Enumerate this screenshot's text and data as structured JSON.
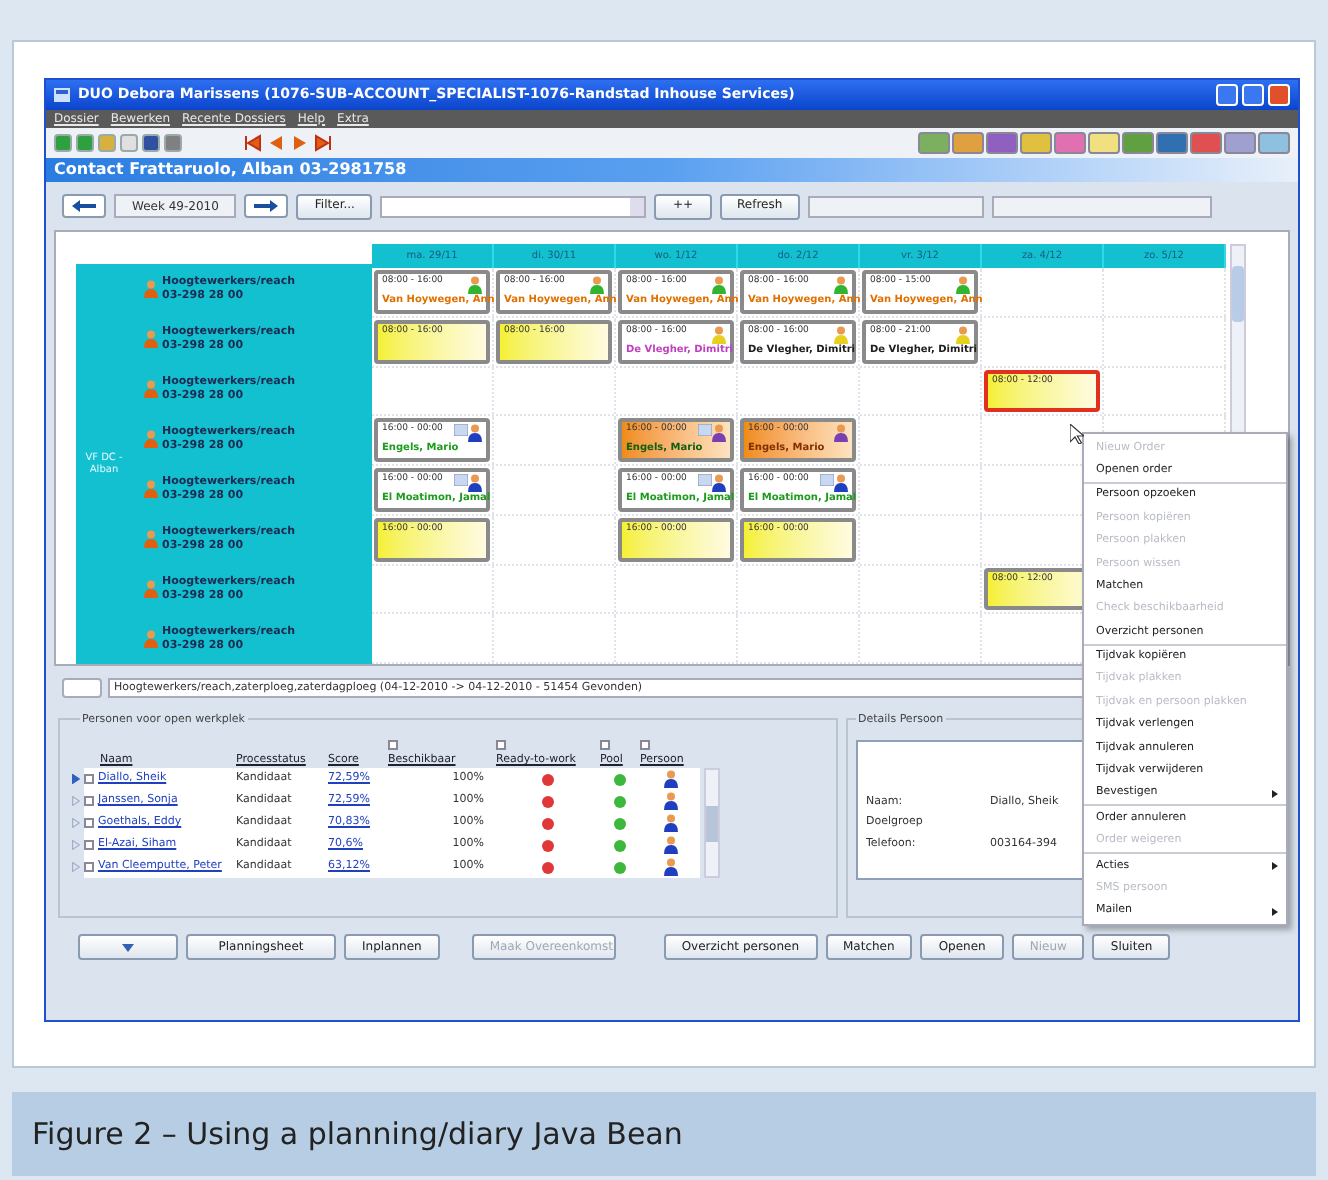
{
  "window": {
    "title": "DUO Debora Marissens (1076-SUB-ACCOUNT_SPECIALIST-1076-Randstad Inhouse Services)"
  },
  "menu": [
    "Dossier",
    "Bewerken",
    "Recente Dossiers",
    "Help",
    "Extra"
  ],
  "header": "Contact Frattaruolo, Alban 03-2981758",
  "nav": {
    "week": "Week 49-2010",
    "filter": "Filter...",
    "plus": "++",
    "refresh": "Refresh"
  },
  "calendar": {
    "group": "VF DC - Alban",
    "days": [
      "ma. 29/11",
      "di. 30/11",
      "wo. 1/12",
      "do. 2/12",
      "vr. 3/12",
      "za. 4/12",
      "zo. 5/12"
    ],
    "rows": [
      {
        "label": "Hoogtewerkers/reach",
        "phone": "03-298 28 00",
        "cells": [
          {
            "kind": "white",
            "time": "08:00 - 16:00",
            "name": "Van Hoywegen, Ann",
            "color": "#e07000",
            "person": {
              "color": "#2fb52f"
            },
            "note": false,
            "selected": false
          },
          {
            "kind": "white",
            "time": "08:00 - 16:00",
            "name": "Van Hoywegen, Ann",
            "color": "#e07000",
            "person": {
              "color": "#2fb52f"
            },
            "note": false,
            "selected": false
          },
          {
            "kind": "white",
            "time": "08:00 - 16:00",
            "name": "Van Hoywegen, Ann",
            "color": "#e07000",
            "person": {
              "color": "#2fb52f"
            },
            "note": false,
            "selected": false
          },
          {
            "kind": "white",
            "time": "08:00 - 16:00",
            "name": "Van Hoywegen, Ann",
            "color": "#e07000",
            "person": {
              "color": "#2fb52f"
            },
            "note": false,
            "selected": false
          },
          {
            "kind": "white",
            "time": "08:00 - 15:00",
            "name": "Van Hoywegen, Ann",
            "color": "#e07000",
            "person": {
              "color": "#2fb52f"
            },
            "note": false,
            "selected": false
          },
          {
            "kind": "empty"
          },
          {
            "kind": "empty"
          }
        ]
      },
      {
        "label": "Hoogtewerkers/reach",
        "phone": "03-298 28 00",
        "cells": [
          {
            "kind": "yellow",
            "time": "08:00 - 16:00",
            "selected": false
          },
          {
            "kind": "yellow",
            "time": "08:00 - 16:00",
            "selected": false
          },
          {
            "kind": "white",
            "time": "08:00 - 16:00",
            "name": "De Vlegher, Dimitri",
            "color": "#c040c0",
            "person": {
              "color": "#e8d020"
            },
            "note": false,
            "selected": false
          },
          {
            "kind": "white",
            "time": "08:00 - 16:00",
            "name": "De Vlegher, Dimitri",
            "color": "#202020",
            "person": {
              "color": "#e8d020"
            },
            "note": false,
            "selected": false
          },
          {
            "kind": "white",
            "time": "08:00 - 21:00",
            "name": "De Vlegher, Dimitri",
            "color": "#202020",
            "person": {
              "color": "#e8d020"
            },
            "note": false,
            "selected": false
          },
          {
            "kind": "empty"
          },
          {
            "kind": "empty"
          }
        ]
      },
      {
        "label": "Hoogtewerkers/reach",
        "phone": "03-298 28 00",
        "cells": [
          {
            "kind": "empty"
          },
          {
            "kind": "empty"
          },
          {
            "kind": "empty"
          },
          {
            "kind": "empty"
          },
          {
            "kind": "empty"
          },
          {
            "kind": "yellow",
            "time": "08:00 - 12:00",
            "selected": true
          },
          {
            "kind": "empty"
          }
        ]
      },
      {
        "label": "Hoogtewerkers/reach",
        "phone": "03-298 28 00",
        "cells": [
          {
            "kind": "white",
            "time": "16:00 - 00:00",
            "name": "Engels, Mario",
            "color": "#1c9c1c",
            "person": {
              "color": "#1f3fc0"
            },
            "note": true,
            "selected": false
          },
          {
            "kind": "empty"
          },
          {
            "kind": "orange",
            "time": "16:00 - 00:00",
            "name": "Engels, Mario",
            "color": "#106010",
            "person": {
              "color": "#7a3fb0"
            },
            "note": true,
            "selected": false
          },
          {
            "kind": "orange",
            "time": "16:00 - 00:00",
            "name": "Engels, Mario",
            "color": "#803000",
            "person": {
              "color": "#7a3fb0"
            },
            "note": false,
            "selected": false
          },
          {
            "kind": "empty"
          },
          {
            "kind": "empty"
          },
          {
            "kind": "empty"
          }
        ]
      },
      {
        "label": "Hoogtewerkers/reach",
        "phone": "03-298 28 00",
        "cells": [
          {
            "kind": "white",
            "time": "16:00 - 00:00",
            "name": "El Moatimon, Jamal",
            "color": "#1c9c1c",
            "person": {
              "color": "#1f3fc0"
            },
            "note": true,
            "selected": false
          },
          {
            "kind": "empty"
          },
          {
            "kind": "white",
            "time": "16:00 - 00:00",
            "name": "El Moatimon, Jamal",
            "color": "#1c9c1c",
            "person": {
              "color": "#1f3fc0"
            },
            "note": true,
            "selected": false
          },
          {
            "kind": "white",
            "time": "16:00 - 00:00",
            "name": "El Moatimon, Jamal",
            "color": "#1c9c1c",
            "person": {
              "color": "#1f3fc0"
            },
            "note": true,
            "selected": false
          },
          {
            "kind": "empty"
          },
          {
            "kind": "empty"
          },
          {
            "kind": "empty"
          }
        ]
      },
      {
        "label": "Hoogtewerkers/reach",
        "phone": "03-298 28 00",
        "cells": [
          {
            "kind": "yellow",
            "time": "16:00 - 00:00",
            "selected": false
          },
          {
            "kind": "empty"
          },
          {
            "kind": "yellow",
            "time": "16:00 - 00:00",
            "selected": false
          },
          {
            "kind": "yellow",
            "time": "16:00 - 00:00",
            "selected": false
          },
          {
            "kind": "empty"
          },
          {
            "kind": "empty"
          },
          {
            "kind": "empty"
          }
        ]
      },
      {
        "label": "Hoogtewerkers/reach",
        "phone": "03-298 28 00",
        "cells": [
          {
            "kind": "empty"
          },
          {
            "kind": "empty"
          },
          {
            "kind": "empty"
          },
          {
            "kind": "empty"
          },
          {
            "kind": "empty"
          },
          {
            "kind": "yellow",
            "time": "08:00 - 12:00",
            "selected": false
          },
          {
            "kind": "empty"
          }
        ]
      },
      {
        "label": "Hoogtewerkers/reach",
        "phone": "03-298 28 00",
        "cells": [
          {
            "kind": "empty"
          },
          {
            "kind": "empty"
          },
          {
            "kind": "empty"
          },
          {
            "kind": "empty"
          },
          {
            "kind": "empty"
          },
          {
            "kind": "empty"
          },
          {
            "kind": "empty"
          }
        ]
      }
    ]
  },
  "context_menu": [
    [
      {
        "label": "Nieuw Order",
        "disabled": true
      },
      {
        "label": "Openen order",
        "disabled": false
      }
    ],
    [
      {
        "label": "Persoon opzoeken",
        "disabled": false
      },
      {
        "label": "Persoon kopiëren",
        "disabled": true
      },
      {
        "label": "Persoon plakken",
        "disabled": true
      },
      {
        "label": "Persoon wissen",
        "disabled": true
      },
      {
        "label": "Matchen",
        "disabled": false
      },
      {
        "label": "Check beschikbaarheid",
        "disabled": true
      },
      {
        "label": "Overzicht personen",
        "disabled": false
      }
    ],
    [
      {
        "label": "Tijdvak kopiëren",
        "disabled": false
      },
      {
        "label": "Tijdvak plakken",
        "disabled": true
      },
      {
        "label": "Tijdvak en persoon plakken",
        "disabled": true
      },
      {
        "label": "Tijdvak verlengen",
        "disabled": false
      },
      {
        "label": "Tijdvak annuleren",
        "disabled": false
      },
      {
        "label": "Tijdvak verwijderen",
        "disabled": false
      },
      {
        "label": "Bevestigen",
        "disabled": false,
        "submenu": true
      }
    ],
    [
      {
        "label": "Order annuleren",
        "disabled": false
      },
      {
        "label": "Order weigeren",
        "disabled": true
      }
    ],
    [
      {
        "label": "Acties",
        "disabled": false,
        "submenu": true
      },
      {
        "label": "SMS persoon",
        "disabled": true
      },
      {
        "label": "Mailen",
        "disabled": false,
        "submenu": true
      }
    ]
  ],
  "search_result": "Hoogtewerkers/reach,zaterploeg,zaterdagploeg (04-12-2010 -> 04-12-2010 - 51454 Gevonden)",
  "persons": {
    "title": "Personen voor open werkplek",
    "columns": [
      {
        "label": "Naam"
      },
      {
        "label": "Processtatus"
      },
      {
        "label": "Score"
      },
      {
        "label": "Beschikbaar",
        "checked": false
      },
      {
        "label": "Ready-to-work",
        "checked": false
      },
      {
        "label": "Pool",
        "checked": false
      },
      {
        "label": "Persoon",
        "checked": false
      }
    ],
    "rows": [
      {
        "name": "Diallo, Sheik",
        "status": "Kandidaat",
        "score": "72,59%",
        "available": "100%",
        "ready": false,
        "pool": true,
        "checked": false,
        "selected": true
      },
      {
        "name": "Janssen, Sonja",
        "status": "Kandidaat",
        "score": "72,59%",
        "available": "100%",
        "ready": false,
        "pool": true,
        "checked": false,
        "selected": false
      },
      {
        "name": "Goethals, Eddy",
        "status": "Kandidaat",
        "score": "70,83%",
        "available": "100%",
        "ready": false,
        "pool": true,
        "checked": false,
        "selected": false
      },
      {
        "name": "El-Azai, Siham",
        "status": "Kandidaat",
        "score": "70,6%",
        "available": "100%",
        "ready": false,
        "pool": true,
        "checked": false,
        "selected": false
      },
      {
        "name": "Van Cleemputte, Peter",
        "status": "Kandidaat",
        "score": "63,12%",
        "available": "100%",
        "ready": false,
        "pool": true,
        "checked": false,
        "selected": false
      }
    ]
  },
  "details": {
    "title": "Details Persoon",
    "fields": [
      {
        "label": "Naam:",
        "value": "Diallo, Sheik"
      },
      {
        "label": "Doelgroep"
      },
      {
        "label": "Telefoon:",
        "value": "003164-394"
      }
    ]
  },
  "buttons": [
    {
      "label": "Planningsheet",
      "disabled": false
    },
    {
      "label": "Inplannen",
      "disabled": false
    },
    {
      "label": "Maak Overeenkomst",
      "disabled": true
    },
    {
      "label": "Overzicht personen",
      "disabled": false
    },
    {
      "label": "Matchen",
      "disabled": false
    },
    {
      "label": "Openen",
      "disabled": false
    },
    {
      "label": "Nieuw",
      "disabled": true
    },
    {
      "label": "Sluiten",
      "disabled": false
    }
  ],
  "caption": "Figure 2 – Using a planning/diary Java Bean"
}
